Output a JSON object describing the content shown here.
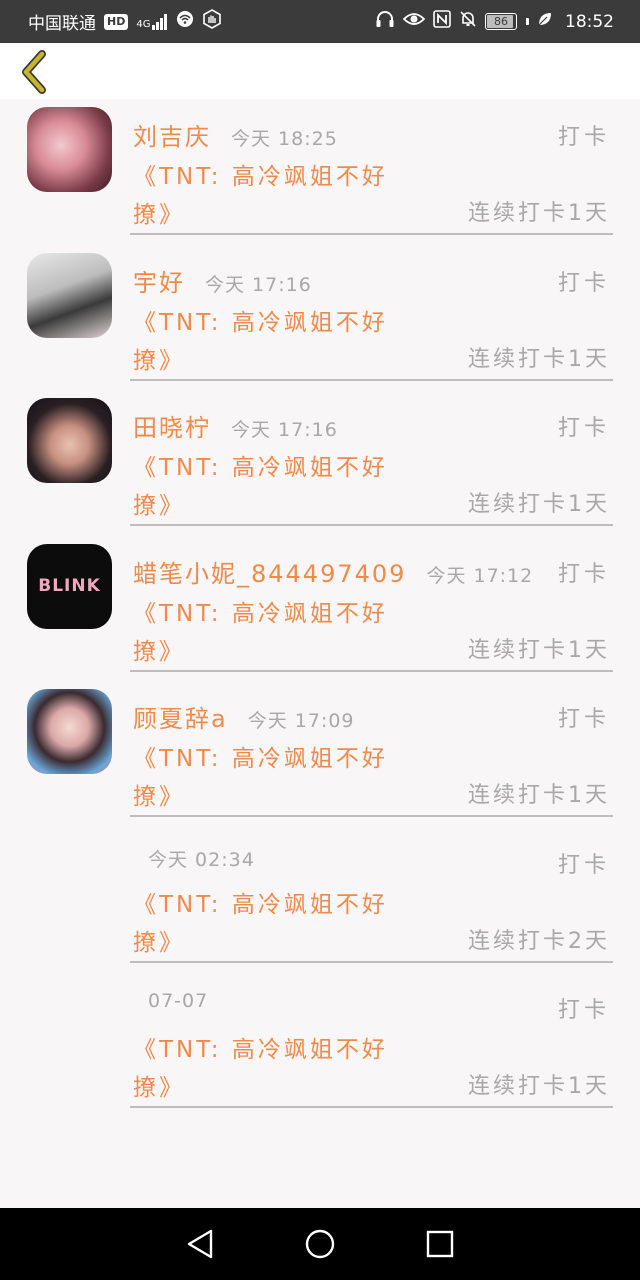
{
  "status_bar": {
    "carrier": "中国联通",
    "hd_badge": "HD",
    "network": "4G",
    "battery_level": "86",
    "time": "18:52",
    "icons": [
      "wifi-icon",
      "hand-icon",
      "headphones-icon",
      "eye-icon",
      "nfc-icon",
      "mute-bell-icon",
      "battery-icon",
      "leaf-icon"
    ]
  },
  "header": {
    "back_icon": "chevron-left-icon",
    "accent": "#c9b52c"
  },
  "colors": {
    "name": "#f08a4a",
    "secondary": "#a8a8a8",
    "background": "#f8f6f7"
  },
  "records": [
    {
      "name": "刘吉庆",
      "time": "今天 18:25",
      "action": "打卡",
      "book_line1": "《TNT: 高冷飒姐不好",
      "book_line2": "撩》",
      "streak": "连续打卡1天"
    },
    {
      "name": "宇好",
      "time": "今天 17:16",
      "action": "打卡",
      "book_line1": "《TNT: 高冷飒姐不好",
      "book_line2": "撩》",
      "streak": "连续打卡1天"
    },
    {
      "name": "田晓柠",
      "time": "今天 17:16",
      "action": "打卡",
      "book_line1": "《TNT: 高冷飒姐不好",
      "book_line2": "撩》",
      "streak": "连续打卡1天"
    },
    {
      "name": "蜡笔小妮_844497409",
      "time": "今天 17:12",
      "action": "打卡",
      "book_line1": "《TNT: 高冷飒姐不好",
      "book_line2": "撩》",
      "streak": "连续打卡1天",
      "avatar_text": "BLINK"
    },
    {
      "name": "顾夏辞a",
      "time": "今天 17:09",
      "action": "打卡",
      "book_line1": "《TNT: 高冷飒姐不好",
      "book_line2": "撩》",
      "streak": "连续打卡1天"
    },
    {
      "name": "",
      "time": "今天 02:34",
      "action": "打卡",
      "book_line1": "《TNT: 高冷飒姐不好",
      "book_line2": "撩》",
      "streak": "连续打卡2天"
    },
    {
      "name": "",
      "time": "07-07",
      "action": "打卡",
      "book_line1": "《TNT: 高冷飒姐不好",
      "book_line2": "撩》",
      "streak": "连续打卡1天"
    }
  ],
  "nav_bar": {
    "icons": [
      "back-triangle-icon",
      "home-circle-icon",
      "recents-square-icon"
    ]
  }
}
